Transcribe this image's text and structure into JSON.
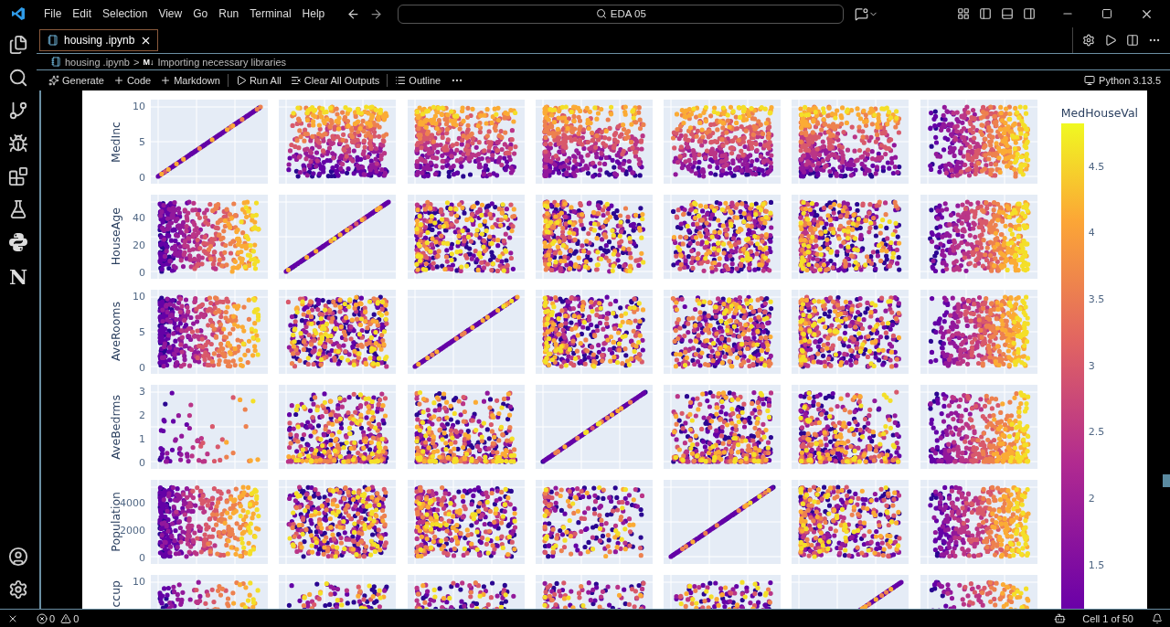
{
  "title_bar": {
    "menu": [
      "File",
      "Edit",
      "Selection",
      "View",
      "Go",
      "Run",
      "Terminal",
      "Help"
    ],
    "search": "EDA 05"
  },
  "activity_bar": {
    "extension_letter": "N"
  },
  "tabs": [
    {
      "label": "housing .ipynb",
      "selected": true
    }
  ],
  "breadcrumb": {
    "file": "housing .ipynb",
    "separator": ">",
    "marker": "M↓",
    "section": "Importing necessary libraries"
  },
  "toolbar": {
    "actions": [
      {
        "kind": "generate",
        "label": "Generate"
      },
      {
        "kind": "add",
        "label": "Code"
      },
      {
        "kind": "add",
        "label": "Markdown"
      },
      {
        "kind": "run",
        "label": "Run All"
      },
      {
        "kind": "clear",
        "label": "Clear All Outputs"
      },
      {
        "kind": "outline",
        "label": "Outline"
      }
    ],
    "kernel": "Python 3.13.5"
  },
  "plot": {
    "rows": [
      {
        "label": "MedInc",
        "ticks": [
          "10",
          "5",
          "0"
        ],
        "panels": [
          {
            "kind": "diagonal"
          },
          {
            "kind": "scatter"
          },
          {
            "kind": "scatter"
          },
          {
            "kind": "scatter"
          },
          {
            "kind": "scatter"
          },
          {
            "kind": "scatter"
          },
          {
            "kind": "scatter"
          }
        ]
      },
      {
        "label": "HouseAge",
        "ticks": [
          "40",
          "20",
          "0"
        ],
        "panels": [
          {
            "kind": "scatter"
          },
          {
            "kind": "diagonal"
          },
          {
            "kind": "scatter"
          },
          {
            "kind": "scatter"
          },
          {
            "kind": "scatter"
          },
          {
            "kind": "scatter"
          },
          {
            "kind": "scatter"
          }
        ]
      },
      {
        "label": "AveRooms",
        "ticks": [
          "10",
          "5",
          "0"
        ],
        "panels": [
          {
            "kind": "scatter"
          },
          {
            "kind": "scatter"
          },
          {
            "kind": "diagonal"
          },
          {
            "kind": "scatter"
          },
          {
            "kind": "scatter"
          },
          {
            "kind": "scatter"
          },
          {
            "kind": "scatter"
          }
        ]
      },
      {
        "label": "AveBedrms",
        "ticks": [
          "3",
          "2",
          "1",
          "0"
        ],
        "panels": [
          {
            "kind": "scatter"
          },
          {
            "kind": "scatter"
          },
          {
            "kind": "scatter"
          },
          {
            "kind": "diagonal"
          },
          {
            "kind": "scatter"
          },
          {
            "kind": "scatter"
          },
          {
            "kind": "scatter"
          }
        ]
      },
      {
        "label": "Population",
        "ticks": [
          "4000",
          "2000",
          "0"
        ],
        "panels": [
          {
            "kind": "scatter"
          },
          {
            "kind": "scatter"
          },
          {
            "kind": "scatter"
          },
          {
            "kind": "scatter"
          },
          {
            "kind": "diagonal"
          },
          {
            "kind": "scatter"
          },
          {
            "kind": "scatter"
          }
        ]
      },
      {
        "label": "ccup",
        "ticks": [
          "10"
        ],
        "panels": [
          {
            "kind": "scatter"
          },
          {
            "kind": "scatter"
          },
          {
            "kind": "scatter"
          },
          {
            "kind": "scatter"
          },
          {
            "kind": "scatter"
          },
          {
            "kind": "diagonal"
          },
          {
            "kind": "scatter"
          }
        ]
      }
    ],
    "colorbar": {
      "title": "MedHouseVal",
      "ticks": [
        "4.5",
        "4",
        "3.5",
        "3",
        "2.5",
        "2",
        "1.5"
      ]
    }
  },
  "status_bar": {
    "errors": "0",
    "warnings": "0",
    "cell": "Cell 1 of 50"
  }
}
